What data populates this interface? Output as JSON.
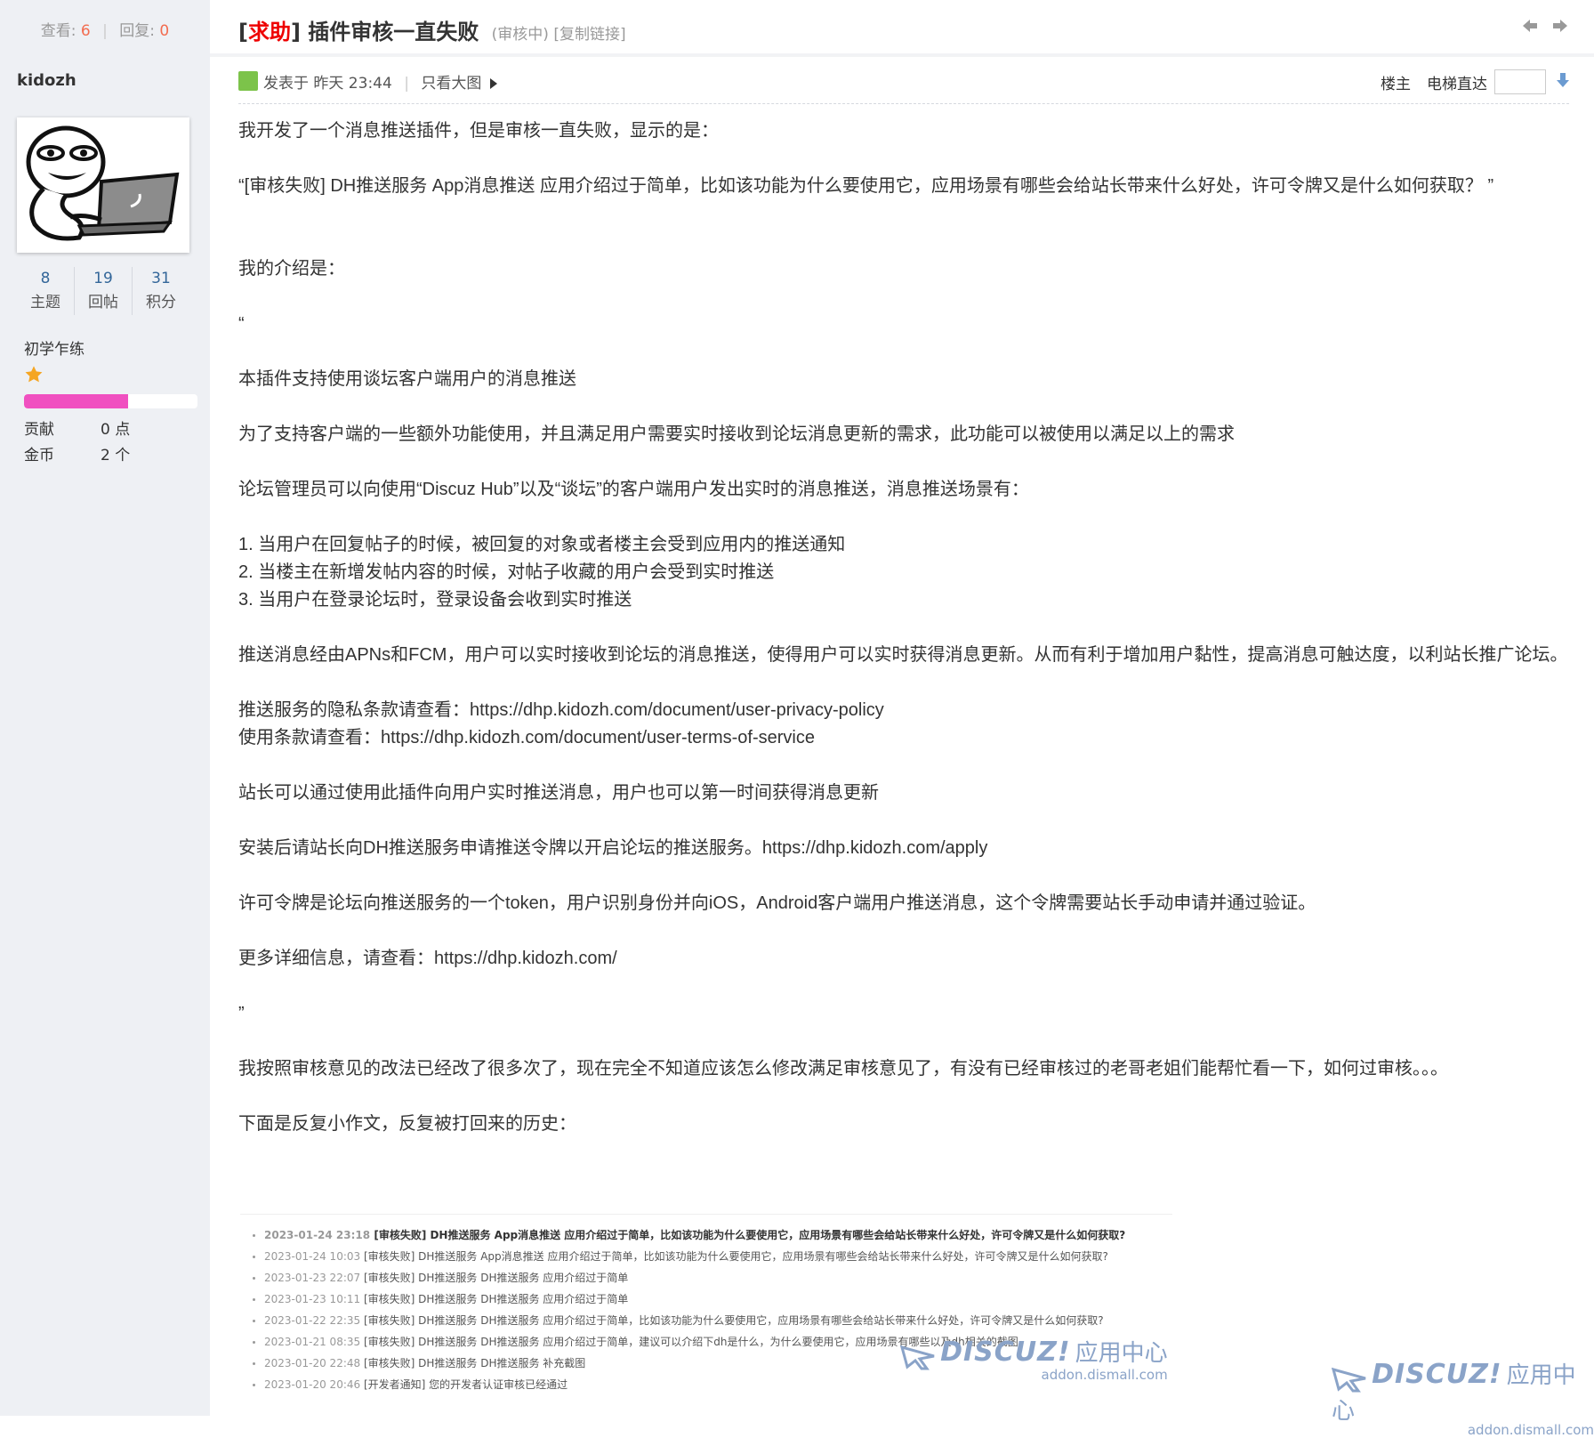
{
  "sidebar": {
    "views_label": "查看:",
    "views": "6",
    "replies_label": "回复:",
    "replies": "0",
    "username": "kidozh",
    "stats": [
      {
        "value": "8",
        "label": "主题"
      },
      {
        "value": "19",
        "label": "回帖"
      },
      {
        "value": "31",
        "label": "积分"
      }
    ],
    "rank": "初学乍练",
    "rank_progress": 0.6,
    "credits": [
      {
        "label": "贡献",
        "value": "0 点"
      },
      {
        "label": "金币",
        "value": "2 个"
      }
    ]
  },
  "thread": {
    "bracket_open": "[",
    "tag": "求助",
    "bracket_close": "]",
    "title": " 插件审核一直失败",
    "status": "(审核中) [复制链接]"
  },
  "post": {
    "posted_at": "发表于 昨天 23:44",
    "sep": "|",
    "only_big_image": "只看大图",
    "floor": "楼主",
    "elevator": "电梯直达"
  },
  "content": [
    "我开发了一个消息推送插件，但是审核一直失败，显示的是：",
    "",
    "“[审核失败] DH推送服务 App消息推送 应用介绍过于简单，比如该功能为什么要使用它，应用场景有哪些会给站长带来什么好处，许可令牌又是什么如何获取？ ”",
    "",
    "",
    "我的介绍是：",
    "",
    "“",
    "",
    "本插件支持使用谈坛客户端用户的消息推送",
    "",
    "为了支持客户端的一些额外功能使用，并且满足用户需要实时接收到论坛消息更新的需求，此功能可以被使用以满足以上的需求",
    "",
    "论坛管理员可以向使用“Discuz Hub”以及“谈坛”的客户端用户发出实时的消息推送，消息推送场景有：",
    "",
    "1. 当用户在回复帖子的时候，被回复的对象或者楼主会受到应用内的推送通知",
    "2. 当楼主在新增发帖内容的时候，对帖子收藏的用户会受到实时推送",
    "3. 当用户在登录论坛时，登录设备会收到实时推送",
    "",
    "推送消息经由APNs和FCM，用户可以实时接收到论坛的消息推送，使得用户可以实时获得消息更新。从而有利于增加用户黏性，提高消息可触达度，以利站长推广论坛。",
    "",
    "推送服务的隐私条款请查看：https://dhp.kidozh.com/document/user-privacy-policy",
    "使用条款请查看：https://dhp.kidozh.com/document/user-terms-of-service",
    "",
    "站长可以通过使用此插件向用户实时推送消息，用户也可以第一时间获得消息更新",
    "",
    "安装后请站长向DH推送服务申请推送令牌以开启论坛的推送服务。https://dhp.kidozh.com/apply",
    "",
    "许可令牌是论坛向推送服务的一个token，用户识别身份并向iOS，Android客户端用户推送消息，这个令牌需要站长手动申请并通过验证。",
    "",
    "更多详细信息，请查看：https://dhp.kidozh.com/",
    "",
    "”",
    "",
    "我按照审核意见的改法已经改了很多次了，现在完全不知道应该怎么修改满足审核意见了，有没有已经审核过的老哥老姐们能帮忙看一下，如何过审核。。。",
    "",
    "下面是反复小作文，反复被打回来的历史："
  ],
  "history": [
    {
      "date": "2023-01-24 23:18",
      "text": "[审核失败] DH推送服务 App消息推送 应用介绍过于简单，比如该功能为什么要使用它，应用场景有哪些会给站长带来什么好处，许可令牌又是什么如何获取?",
      "bold": true
    },
    {
      "date": "2023-01-24 10:03",
      "text": "[审核失败] DH推送服务 App消息推送 应用介绍过于简单，比如该功能为什么要使用它，应用场景有哪些会给站长带来什么好处，许可令牌又是什么如何获取?",
      "bold": false
    },
    {
      "date": "2023-01-23 22:07",
      "text": "[审核失败] DH推送服务 DH推送服务 应用介绍过于简单",
      "bold": false
    },
    {
      "date": "2023-01-23 10:11",
      "text": "[审核失败] DH推送服务 DH推送服务 应用介绍过于简单",
      "bold": false
    },
    {
      "date": "2023-01-22 22:35",
      "text": "[审核失败] DH推送服务 DH推送服务 应用介绍过于简单，比如该功能为什么要使用它，应用场景有哪些会给站长带来什么好处，许可令牌又是什么如何获取?",
      "bold": false
    },
    {
      "date": "2023-01-21 08:35",
      "text": "[审核失败] DH推送服务 DH推送服务 应用介绍过于简单，建议可以介绍下dh是什么，为什么要使用它，应用场景有哪些以及dh相关的截图",
      "bold": false
    },
    {
      "date": "2023-01-20 22:48",
      "text": "[审核失败] DH推送服务 DH推送服务 补充截图",
      "bold": false
    },
    {
      "date": "2023-01-20 20:46",
      "text": "[开发者通知] 您的开发者认证审核已经通过",
      "bold": false
    }
  ],
  "watermark": {
    "brand": "DISCUZ!",
    "cn": "应用中心",
    "url": "addon.dismall.com"
  },
  "colors": {
    "sidebar_bg": "#eef0f4",
    "tag_red": "#ee0000",
    "count_orange": "#f26c4f",
    "link_blue": "#336699",
    "progress_pink": "#f050c0",
    "star": "#f5a623"
  }
}
